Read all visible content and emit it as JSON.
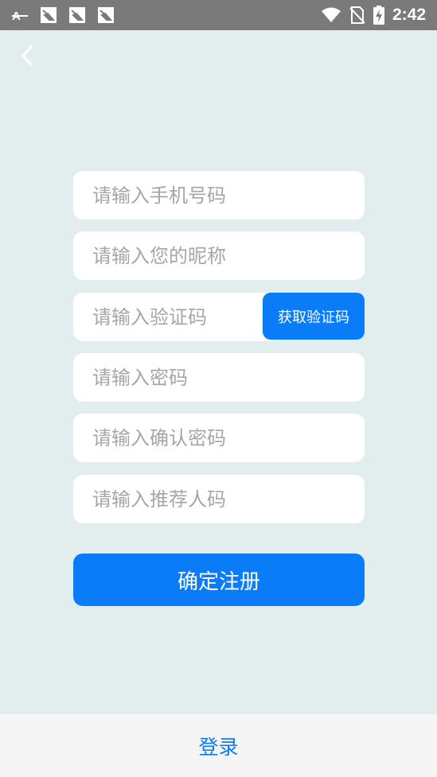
{
  "status_bar": {
    "time": "2:42",
    "icons": [
      "font-icon",
      "notification-icon",
      "notification-icon",
      "notification-icon",
      "wifi-icon",
      "no-sim-icon",
      "battery-charging-icon"
    ]
  },
  "nav": {
    "back_icon": "chevron-left-icon"
  },
  "form": {
    "phone_placeholder": "请输入手机号码",
    "nickname_placeholder": "请输入您的昵称",
    "code_placeholder": "请输入验证码",
    "get_code_label": "获取验证码",
    "password_placeholder": "请输入密码",
    "confirm_password_placeholder": "请输入确认密码",
    "referral_placeholder": "请输入推荐人码",
    "submit_label": "确定注册"
  },
  "footer": {
    "login_label": "登录"
  },
  "colors": {
    "accent": "#0a7cf8",
    "background": "#e1eeed",
    "status_bar": "#7a7a7a"
  }
}
